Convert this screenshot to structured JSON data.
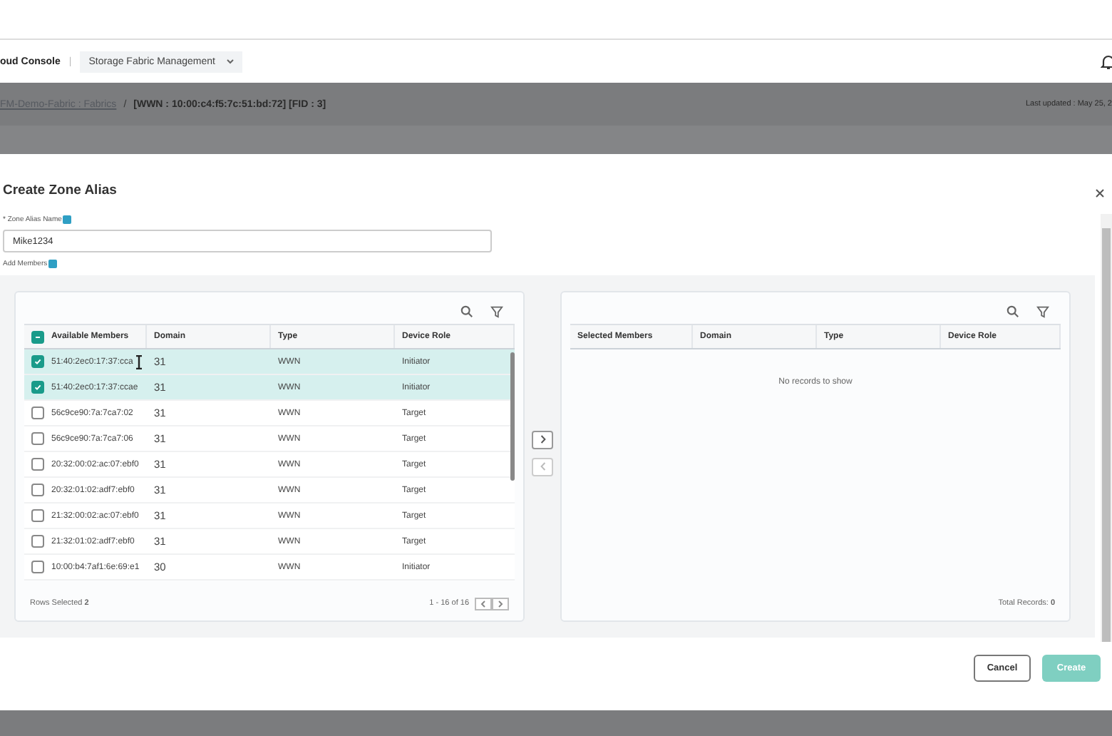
{
  "header": {
    "app_name": "oud Console",
    "separator": "|",
    "product_menu": "Storage Fabric Management"
  },
  "breadcrumb": {
    "link": "FM-Demo-Fabric : Fabrics",
    "separator": "/",
    "current": "[WWN : 10:00:c4:f5:7c:51:bd:72] [FID : 3]",
    "last_updated": "Last updated : May 25, 2"
  },
  "dialog": {
    "title": "Create Zone Alias",
    "name_label": "* Zone Alias Name",
    "name_value": "Mike1234",
    "members_label": "Add Members",
    "available": {
      "select_all": {
        "indeterminate": true
      },
      "columns": [
        "Available Members",
        "Domain",
        "Type",
        "Device Role"
      ],
      "rows": [
        {
          "selected": true,
          "member": "51:40:2ec0:17:37:cca",
          "domain": "31",
          "type": "WWN",
          "role": "Initiator"
        },
        {
          "selected": true,
          "member": "51:40:2ec0:17:37:ccae",
          "domain": "31",
          "type": "WWN",
          "role": "Initiator"
        },
        {
          "selected": false,
          "member": "56c9ce90:7a:7ca7:02",
          "domain": "31",
          "type": "WWN",
          "role": "Target"
        },
        {
          "selected": false,
          "member": "56c9ce90:7a:7ca7:06",
          "domain": "31",
          "type": "WWN",
          "role": "Target"
        },
        {
          "selected": false,
          "member": "20:32:00:02:ac:07:ebf0",
          "domain": "31",
          "type": "WWN",
          "role": "Target"
        },
        {
          "selected": false,
          "member": "20:32:01:02:adf7:ebf0",
          "domain": "31",
          "type": "WWN",
          "role": "Target"
        },
        {
          "selected": false,
          "member": "21:32:00:02:ac:07:ebf0",
          "domain": "31",
          "type": "WWN",
          "role": "Target"
        },
        {
          "selected": false,
          "member": "21:32:01:02:adf7:ebf0",
          "domain": "31",
          "type": "WWN",
          "role": "Target"
        },
        {
          "selected": false,
          "member": "10:00:b4:7af1:6e:69:e1",
          "domain": "30",
          "type": "WWN",
          "role": "Initiator"
        }
      ],
      "footer_left": "Rows Selected **2**",
      "footer_right": "1 - 16 of 16"
    },
    "selected": {
      "columns": [
        "Selected Members",
        "Domain",
        "Type",
        "Device Role"
      ],
      "empty_text": "No records to show",
      "footer_right": "Total Records: **0**"
    },
    "buttons": [
      {
        "label": "Cancel",
        "kind": "secondary",
        "disabled": false
      },
      {
        "label": "Create",
        "kind": "primary",
        "disabled": true
      }
    ]
  }
}
